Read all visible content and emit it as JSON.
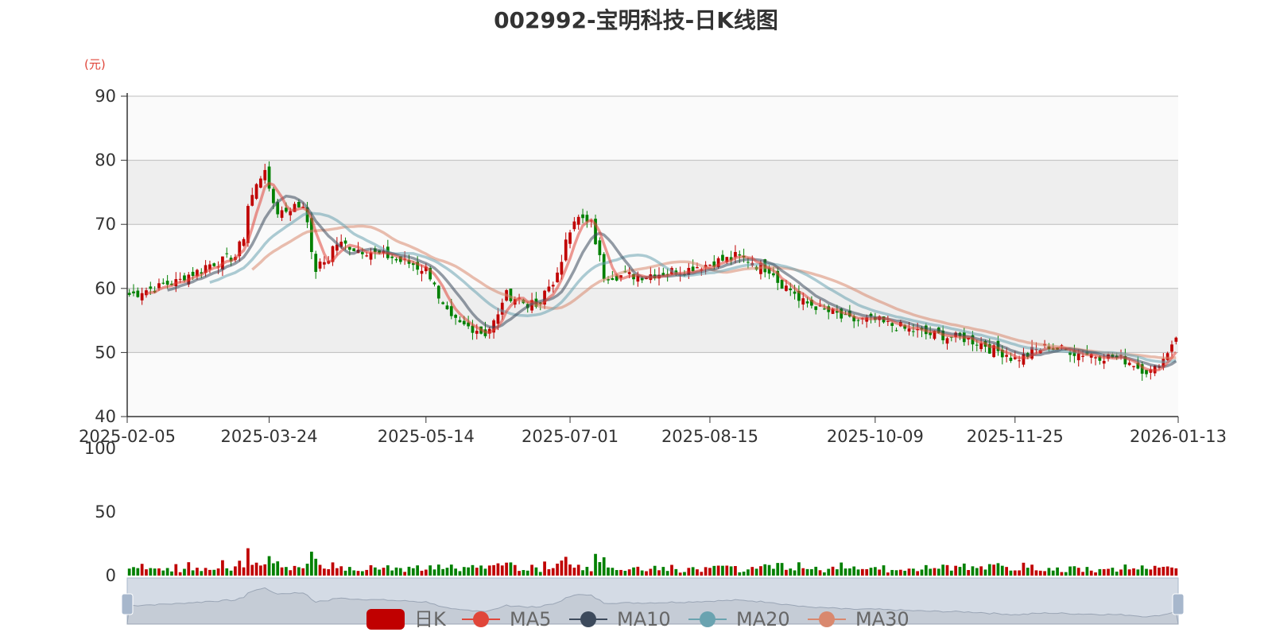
{
  "title": "002992-宝明科技-日K线图",
  "unit_label": "(元)",
  "colors": {
    "up": "#c00000",
    "down": "#008000",
    "ma5": "#e0463a",
    "ma10": "#3d4a5c",
    "ma20": "#6aa3b0",
    "ma30": "#d9886e",
    "grid": "#bdbdbd",
    "band": "#eeeeee",
    "slider_fill": "#d4dbe5"
  },
  "chart_data": {
    "type": "candlestick",
    "title": "002992-宝明科技-日K线图",
    "ylabel": "(元)",
    "price_axis": {
      "min": 40,
      "max": 90,
      "ticks": [
        "90",
        "80",
        "70",
        "60",
        "50",
        "40"
      ]
    },
    "volume_axis": {
      "min": 0,
      "max": 100,
      "ticks": [
        "100",
        "50",
        "0"
      ]
    },
    "x_tick_labels": [
      "2025-02-05",
      "2025-03-24",
      "2025-05-14",
      "2025-07-01",
      "2025-08-15",
      "2025-10-09",
      "2025-11-25",
      "2026-01-13"
    ],
    "close_trend": [
      [
        "2025-02-05",
        59
      ],
      [
        "2025-02-20",
        61
      ],
      [
        "2025-03-05",
        64
      ],
      [
        "2025-03-12",
        65
      ],
      [
        "2025-03-17",
        73
      ],
      [
        "2025-03-21",
        79
      ],
      [
        "2025-03-26",
        72
      ],
      [
        "2025-04-03",
        73
      ],
      [
        "2025-04-08",
        63
      ],
      [
        "2025-04-15",
        67
      ],
      [
        "2025-05-01",
        65
      ],
      [
        "2025-05-14",
        63
      ],
      [
        "2025-05-22",
        55
      ],
      [
        "2025-06-03",
        53
      ],
      [
        "2025-06-10",
        59
      ],
      [
        "2025-06-20",
        57
      ],
      [
        "2025-06-26",
        62
      ],
      [
        "2025-07-02",
        71
      ],
      [
        "2025-07-08",
        70
      ],
      [
        "2025-07-11",
        62
      ],
      [
        "2025-07-25",
        62
      ],
      [
        "2025-08-08",
        63
      ],
      [
        "2025-08-25",
        65
      ],
      [
        "2025-09-04",
        63
      ],
      [
        "2025-09-15",
        58
      ],
      [
        "2025-10-01",
        55
      ],
      [
        "2025-10-09",
        55
      ],
      [
        "2025-10-25",
        53
      ],
      [
        "2025-11-10",
        52
      ],
      [
        "2025-11-25",
        49
      ],
      [
        "2025-12-05",
        51
      ],
      [
        "2025-12-15",
        50
      ],
      [
        "2025-12-30",
        49
      ],
      [
        "2026-01-08",
        47
      ],
      [
        "2026-01-13",
        49
      ],
      [
        "2026-01-17",
        54
      ]
    ],
    "series": [
      {
        "name": "日K"
      },
      {
        "name": "MA5"
      },
      {
        "name": "MA10"
      },
      {
        "name": "MA20"
      },
      {
        "name": "MA30"
      }
    ],
    "legend_position": "bottom-center",
    "grid": true
  }
}
